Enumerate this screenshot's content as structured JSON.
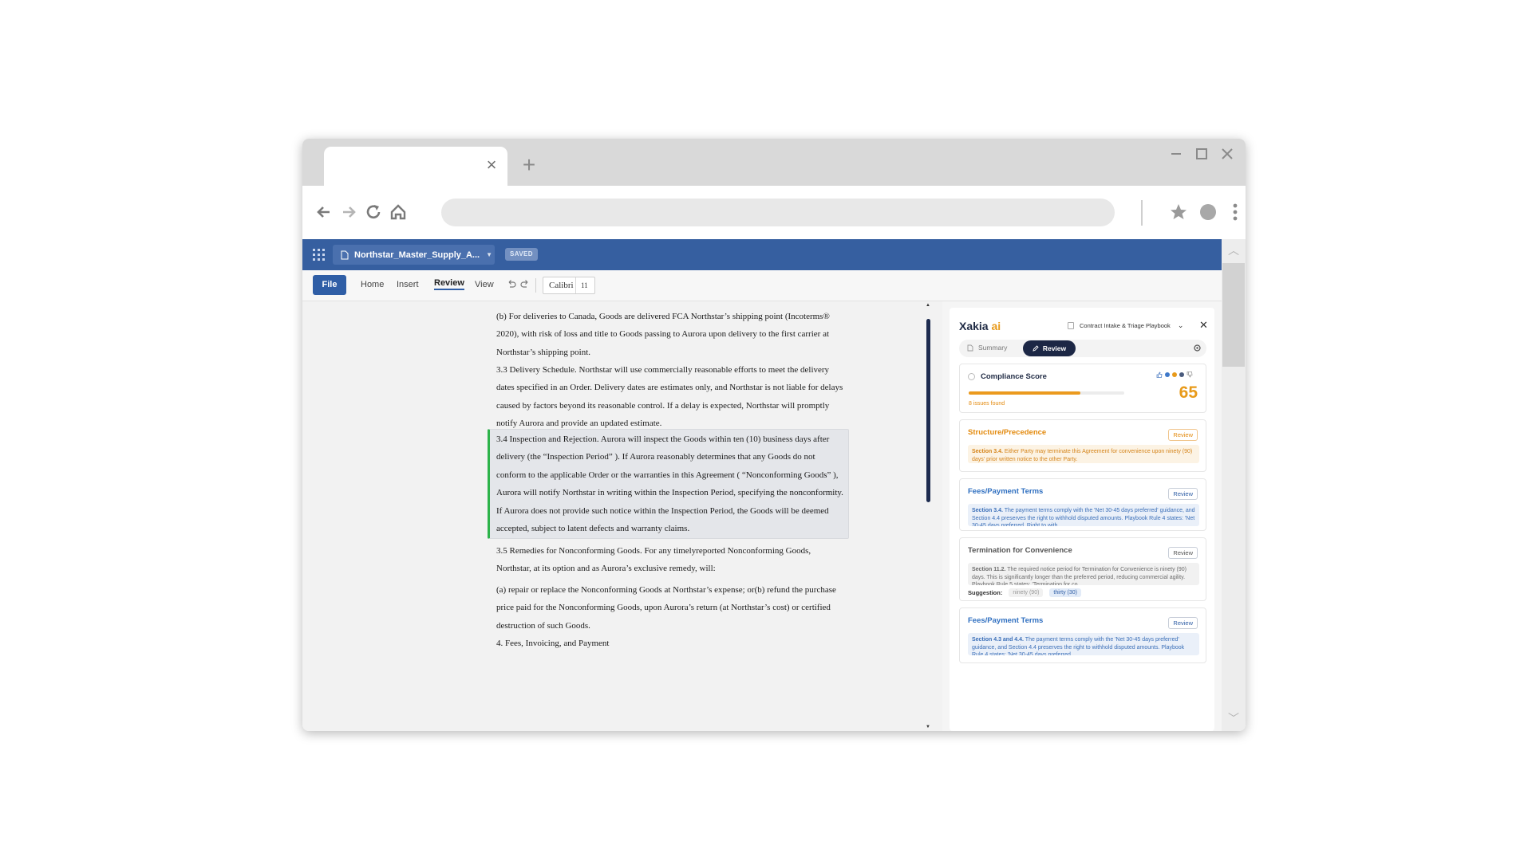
{
  "app": {
    "file_name": "Northstar_Master_Supply_A...",
    "saved_badge": "SAVED",
    "file_button": "File",
    "menus": [
      "Home",
      "Insert",
      "Review",
      "View"
    ],
    "active_menu": "Review",
    "font_name": "Calibri",
    "font_size": "11"
  },
  "document": {
    "paragraphs": [
      "(b) For deliveries to Canada, Goods are delivered FCA Northstar’s shipping point (Incoterms® 2020), with risk of loss and title to Goods passing to Aurora upon delivery to the first carrier at Northstar’s shipping point.",
      "3.3 Delivery Schedule. Northstar will use commercially reasonable efforts to meet the delivery dates specified in an Order. Delivery dates are estimates only, and Northstar is not liable for delays caused by factors beyond its reasonable control. If a delay is expected, Northstar will promptly notify Aurora and provide an updated estimate.",
      "3.4 Inspection and Rejection. Aurora will inspect the Goods within ten (10) business days after delivery (the “Inspection Period” ). If Aurora reasonably determines that any Goods do not conform to the applicable Order or the warranties in this Agreement ( “Nonconforming Goods” ), Aurora will notify Northstar in writing within the Inspection Period, specifying the nonconformity. If Aurora does not provide such notice within the Inspection Period, the Goods will be deemed accepted, subject to latent defects and warranty claims.",
      "3.5 Remedies for Nonconforming Goods. For any timelyreported Nonconforming Goods, Northstar, at its option and as Aurora’s exclusive remedy, will:",
      "(a) repair or replace the Nonconforming Goods at Northstar’s expense; or(b) refund the purchase price paid for the Nonconforming Goods, upon Aurora’s return (at Northstar’s cost) or certified destruction of such Goods.",
      "4. Fees, Invoicing, and Payment"
    ]
  },
  "sidebar": {
    "logo_text": "Xakia",
    "logo_ai": "ai",
    "playbook": "Contract Intake & Triage Playbook",
    "tab_summary": "Summary",
    "tab_review": "Review",
    "compliance": {
      "title": "Compliance Score",
      "score": "65",
      "score_fraction": 0.72,
      "issues_found": "8 issues found"
    },
    "issues": [
      {
        "title": "Structure/Precedence",
        "button": "Review",
        "section": "Section 3.4.",
        "text": " Either Party may terminate this Agreement for convenience upon ninety (90) days' prior written notice to the other Party."
      },
      {
        "title": "Fees/Payment Terms",
        "button": "Review",
        "section": "Section 3.4.",
        "text": " The payment terms comply with the 'Net 30-45 days preferred' guidance, and Section 4.4 preserves the right to withhold disputed amounts. Playbook Rule 4 states: 'Net 30-45 days preferred. Right to with..."
      },
      {
        "title": "Termination for Convenience",
        "button": "Review",
        "section": "Section 11.2.",
        "text": " The required notice period for Termination for Convenience is ninety (90) days. This is significantly longer than the preferred period, reducing commercial agility. Playbook Rule 5 states: 'Termination for co...",
        "suggestion_label": "Suggestion:",
        "suggestion_old": "ninety (90)",
        "suggestion_new": "thirty (30)"
      },
      {
        "title": "Fees/Payment Terms",
        "button": "Review",
        "section": "Section 4.3 and 4.4.",
        "text": " The payment terms comply with the 'Net 30-45 days preferred' guidance, and Section 4.4 preserves the right to withhold disputed amounts. Playbook Rule 4 states: 'Net 30-45 days preferred..."
      }
    ]
  },
  "colors": {
    "appbar": "#365fa0",
    "accent_orange": "#e89a1a",
    "accent_blue": "#2f5ea6",
    "highlight_green": "#2db34a"
  }
}
